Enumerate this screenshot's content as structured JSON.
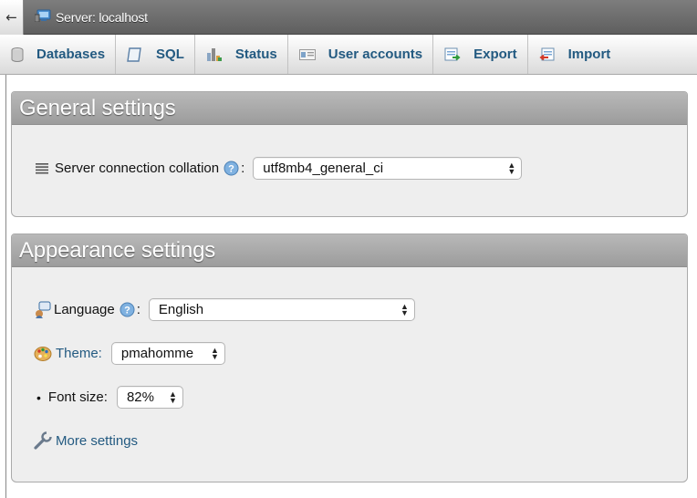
{
  "breadcrumb": {
    "back_glyph": "←",
    "server_label": "Server: localhost"
  },
  "tabs": [
    {
      "label": "Databases",
      "icon": "database-icon"
    },
    {
      "label": "SQL",
      "icon": "sql-icon"
    },
    {
      "label": "Status",
      "icon": "status-chart-icon"
    },
    {
      "label": "User accounts",
      "icon": "user-accounts-icon"
    },
    {
      "label": "Export",
      "icon": "export-icon"
    },
    {
      "label": "Import",
      "icon": "import-icon"
    }
  ],
  "general": {
    "title": "General settings",
    "collation_label": "Server connection collation",
    "collation_value": "utf8mb4_general_ci"
  },
  "appearance": {
    "title": "Appearance settings",
    "language_label": "Language",
    "language_value": "English",
    "theme_label": "Theme:",
    "theme_value": "pmahomme",
    "fontsize_label": "Font size:",
    "fontsize_value": "82%",
    "more_settings": "More settings"
  },
  "punct": {
    "colon": ":"
  },
  "colors": {
    "link": "#235a81",
    "panel_header": "#a9a9a9",
    "topbar": "#6e6e6e"
  }
}
